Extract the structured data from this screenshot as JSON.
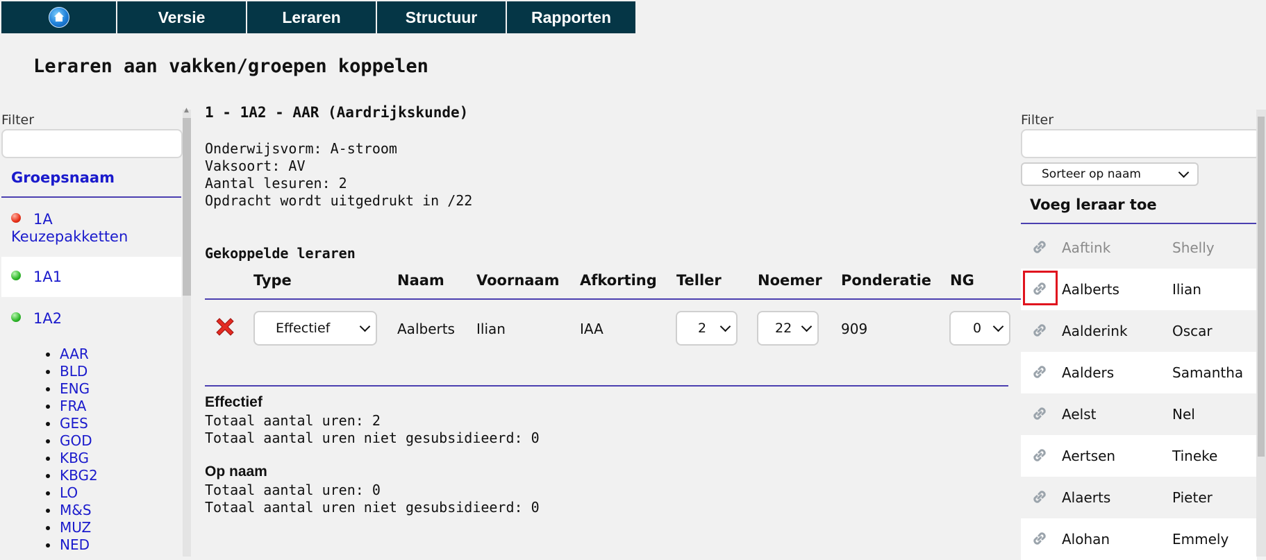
{
  "nav": {
    "home_icon": "home-globe-icon",
    "items": [
      "Versie",
      "Leraren",
      "Structuur",
      "Rapporten"
    ]
  },
  "page_title": "Leraren aan vakken/groepen koppelen",
  "left": {
    "filter_label": "Filter",
    "filter_value": "",
    "column_header": "Groepsnaam",
    "groups": [
      {
        "line1": "1A",
        "line2": "Keuzepakketten",
        "status": "red"
      },
      {
        "line1": "1A1",
        "status": "green"
      },
      {
        "line1": "1A2",
        "status": "green"
      }
    ],
    "subjects": [
      "AAR",
      "BLD",
      "ENG",
      "FRA",
      "GES",
      "GOD",
      "KBG",
      "KBG2",
      "LO",
      "M&S",
      "MUZ",
      "NED"
    ]
  },
  "course": {
    "title": "1 - 1A2 - AAR (Aardrijkskunde)",
    "onderwijsvorm": "Onderwijsvorm: A-stroom",
    "vaksoort": "Vaksoort: AV",
    "lesuren": "Aantal lesuren: 2",
    "opdracht": "Opdracht wordt uitgedrukt in /22"
  },
  "linked": {
    "heading": "Gekoppelde leraren",
    "columns": [
      "Type",
      "Naam",
      "Voornaam",
      "Afkorting",
      "Teller",
      "Noemer",
      "Ponderatie",
      "NG"
    ],
    "row": {
      "type": "Effectief",
      "naam": "Aalberts",
      "voornaam": "Ilian",
      "afkorting": "IAA",
      "teller": "2",
      "noemer": "22",
      "ponderatie": "909",
      "ng": "0"
    }
  },
  "summary": {
    "effectief": {
      "heading": "Effectief",
      "totaal": "Totaal aantal uren: 2",
      "niet_gesubsidieerd": "Totaal aantal uren niet gesubsidieerd: 0"
    },
    "op_naam": {
      "heading": "Op naam",
      "totaal": "Totaal aantal uren: 0",
      "niet_gesubsidieerd": "Totaal aantal uren niet gesubsidieerd: 0"
    }
  },
  "right": {
    "filter_label": "Filter",
    "filter_value": "",
    "sort_label": "Sorteer op naam",
    "heading": "Voeg leraar toe",
    "teachers": [
      {
        "last": "Aaftink",
        "first": "Shelly"
      },
      {
        "last": "Aalberts",
        "first": "Ilian"
      },
      {
        "last": "Aalderink",
        "first": "Oscar"
      },
      {
        "last": "Aalders",
        "first": "Samantha"
      },
      {
        "last": "Aelst",
        "first": "Nel"
      },
      {
        "last": "Aertsen",
        "first": "Tineke"
      },
      {
        "last": "Alaerts",
        "first": "Pieter"
      },
      {
        "last": "Alohan",
        "first": "Emmely"
      }
    ]
  },
  "colors": {
    "nav_bg": "#053646",
    "accent_line": "#4b3fb0",
    "link_text": "#1a1acc",
    "highlight": "#e0141e"
  }
}
